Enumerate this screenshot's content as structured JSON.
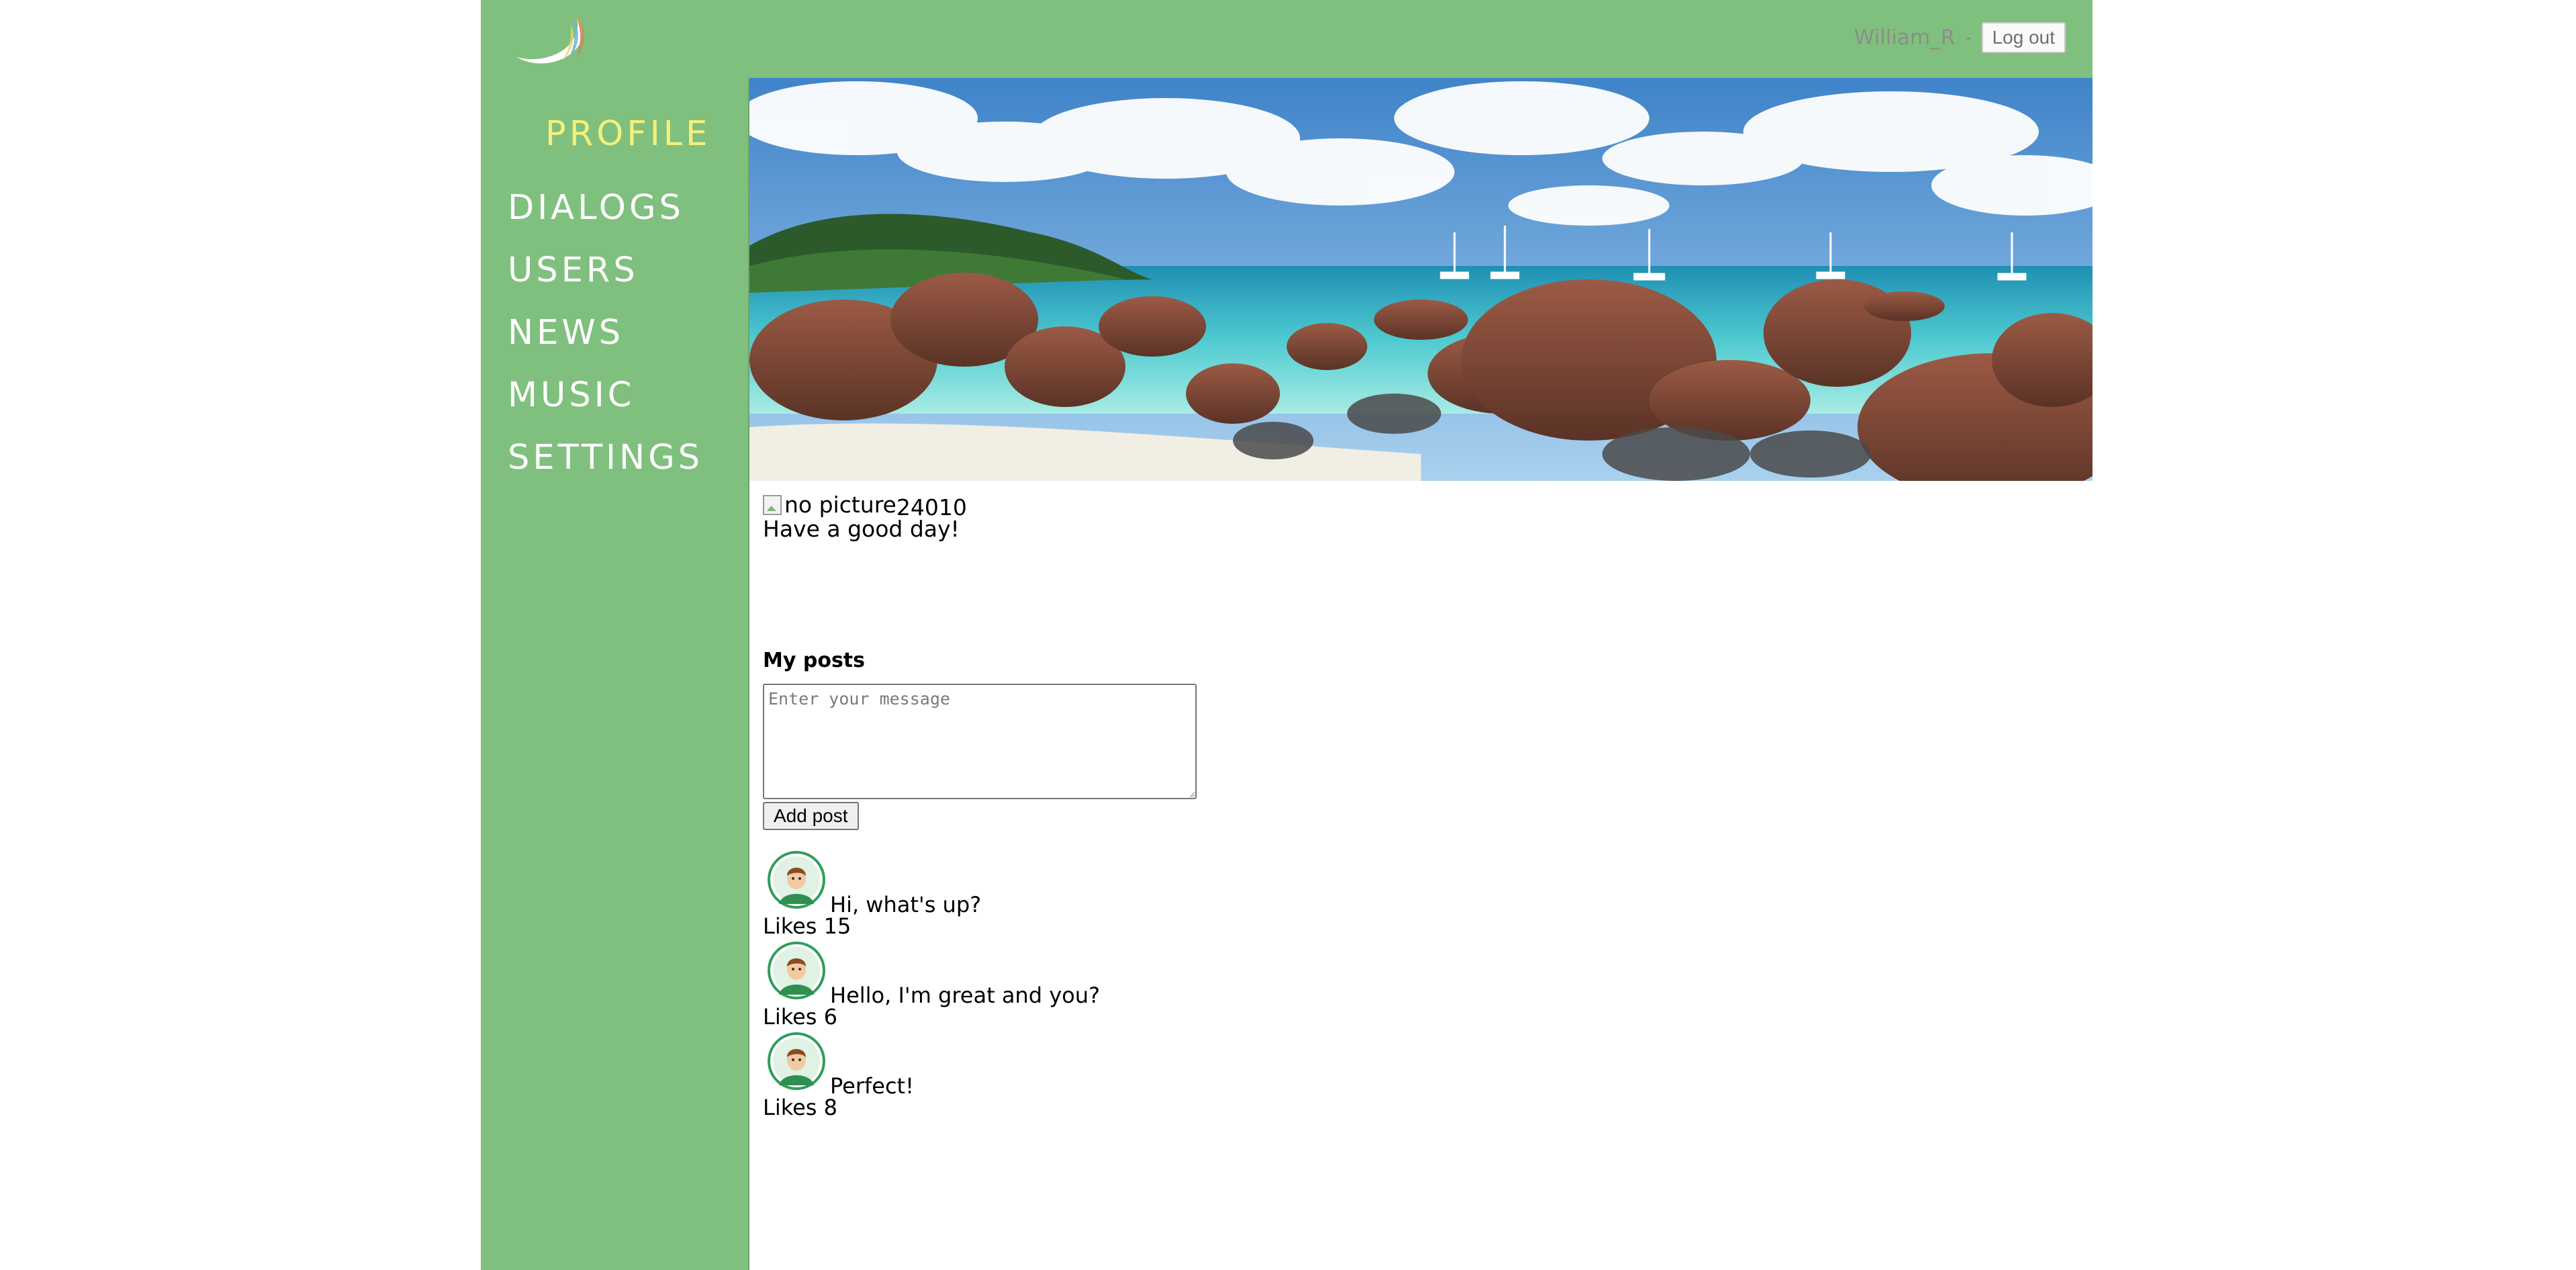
{
  "header": {
    "logo_icon": "swoosh-logo-icon",
    "user_name": "William_R",
    "separator": "-",
    "logout_label": "Log out"
  },
  "nav": {
    "items": [
      {
        "label": "PROFILE",
        "active": true
      },
      {
        "label": "DIALOGS",
        "active": false
      },
      {
        "label": "USERS",
        "active": false
      },
      {
        "label": "NEWS",
        "active": false
      },
      {
        "label": "MUSIC",
        "active": false
      },
      {
        "label": "SETTINGS",
        "active": false
      }
    ]
  },
  "profile": {
    "avatar_alt": "no picture",
    "user_id": "24010",
    "status": "Have a good day!"
  },
  "posts": {
    "title": "My posts",
    "input_placeholder": "Enter your message",
    "add_label": "Add post",
    "items": [
      {
        "message": "Hi, what's up?",
        "likes_label": "Likes",
        "likes": "15"
      },
      {
        "message": "Hello, I'm great and you?",
        "likes_label": "Likes",
        "likes": "6"
      },
      {
        "message": "Perfect!",
        "likes_label": "Likes",
        "likes": "8"
      }
    ]
  },
  "colors": {
    "header_bg": "#80c07e",
    "nav_text": "#ffffff",
    "nav_active": "#f4f07a",
    "sea": "#5ecfd3",
    "avatar_ring": "#2f9e5c"
  }
}
